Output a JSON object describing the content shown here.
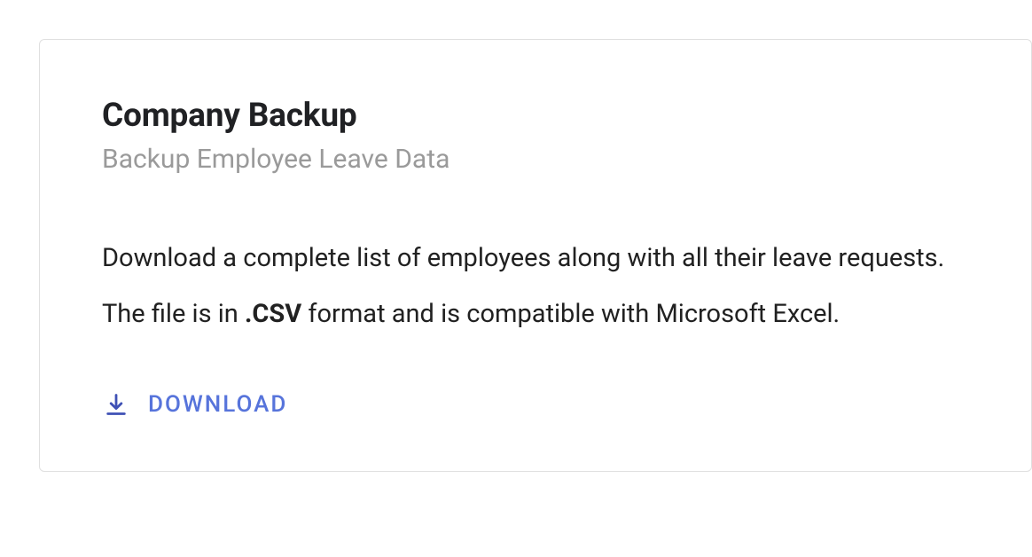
{
  "card": {
    "title": "Company Backup",
    "subtitle": "Backup Employee Leave Data",
    "body_line1": "Download a complete list of employees along with all their leave requests.",
    "body_line2_pre": "The file is in ",
    "body_line2_strong": ".CSV",
    "body_line2_post": " format and is compatible with Microsoft Excel."
  },
  "actions": {
    "download_label": "DOWNLOAD"
  }
}
